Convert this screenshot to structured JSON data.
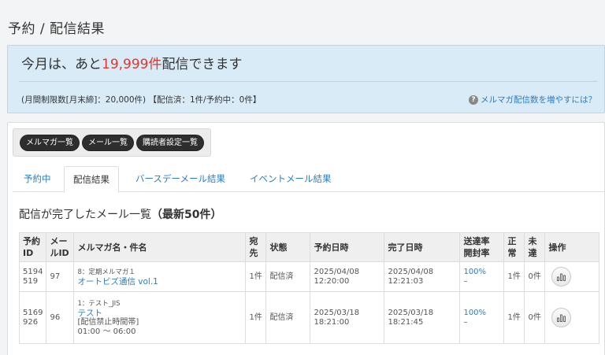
{
  "page": {
    "title": "予約 / 配信結果"
  },
  "quota": {
    "prefix": "今月は、あと",
    "remaining": "19,999件",
    "suffix": "配信できます",
    "detail": "(月間制限数[月末締]：20,000件) 【配信済：1件/予約中：0件】",
    "help_link": "メルマガ配信数を増やすには？"
  },
  "buttons": {
    "newsletter_list": "メルマガ一覧",
    "mail_list": "メール一覧",
    "subscriber_settings": "購読者設定一覧"
  },
  "tabs": [
    {
      "label": "予約中",
      "active": false
    },
    {
      "label": "配信結果",
      "active": true
    },
    {
      "label": "バースデーメール結果",
      "active": false
    },
    {
      "label": "イベントメール結果",
      "active": false
    }
  ],
  "section": {
    "title": "配信が完了したメール一覧",
    "count_note": "（最新50件）"
  },
  "table": {
    "headers": {
      "id_line1": "予約",
      "id_line2": "ID",
      "mail_id_line1": "メー",
      "mail_id_line2": "ルID",
      "name": "メルマガ名・件名",
      "dest_line1": "宛",
      "dest_line2": "先",
      "status": "状態",
      "scheduled": "予約日時",
      "completed": "完了日時",
      "rate_line1": "送達率",
      "rate_line2": "開封率",
      "normal_line1": "正",
      "normal_line2": "常",
      "undelivered_line1": "未",
      "undelivered_line2": "達",
      "operation": "操作"
    },
    "rows": [
      {
        "id_line1": "5194",
        "id_line2": "519",
        "mail_id": "97",
        "newsletter": "8：定期メルマガ１",
        "subject": "オートビズ通信 vol.1",
        "note1": "",
        "note2": "",
        "dest": "1件",
        "status": "配信済",
        "scheduled_date": "2025/04/08",
        "scheduled_time": "12:20:00",
        "completed_date": "2025/04/08",
        "completed_time": "12:21:03",
        "delivery_rate": "100%",
        "open_rate": "–",
        "normal": "1件",
        "undelivered": "0件"
      },
      {
        "id_line1": "5169",
        "id_line2": "926",
        "mail_id": "96",
        "newsletter": "1：テスト_JIS",
        "subject": "テスト",
        "note1": "[配信禁止時間帯]",
        "note2": "01:00 ～ 06:00",
        "dest": "1件",
        "status": "配信済",
        "scheduled_date": "2025/03/18",
        "scheduled_time": "18:21:00",
        "completed_date": "2025/03/18",
        "completed_time": "18:21:45",
        "delivery_rate": "100%",
        "open_rate": "–",
        "normal": "1件",
        "undelivered": "0件"
      }
    ]
  }
}
